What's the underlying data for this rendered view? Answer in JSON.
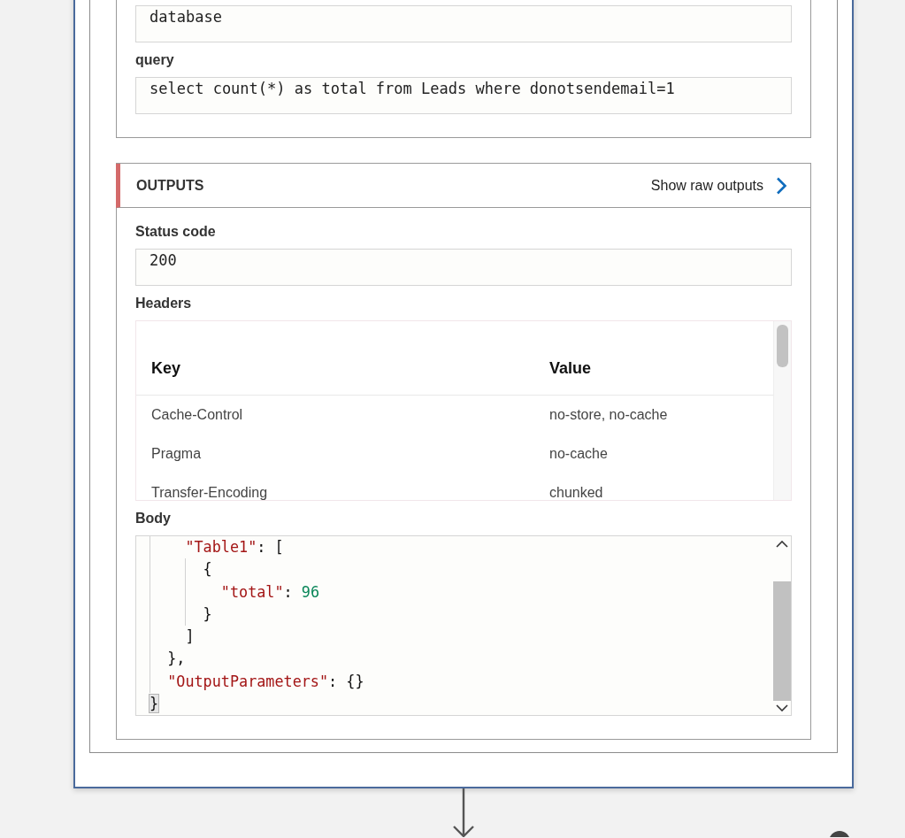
{
  "inputs": {
    "fields": [
      {
        "value": "database"
      },
      {
        "label": "query",
        "value": "select count(*) as total from Leads where donotsendemail=1"
      }
    ]
  },
  "outputs": {
    "title": "OUTPUTS",
    "raw_outputs_link": "Show raw outputs",
    "status_code": {
      "label": "Status code",
      "value": "200"
    },
    "headers": {
      "label": "Headers",
      "columns": [
        "Key",
        "Value"
      ],
      "rows": [
        {
          "key": "Cache-Control",
          "value": "no-store, no-cache"
        },
        {
          "key": "Pragma",
          "value": "no-cache"
        },
        {
          "key": "Transfer-Encoding",
          "value": "chunked"
        }
      ]
    },
    "body": {
      "label": "Body",
      "lines": [
        {
          "tokens": [
            {
              "kind": "key",
              "text": "    \"Table1\""
            },
            {
              "kind": "punct",
              "text": ": ["
            }
          ]
        },
        {
          "tokens": [
            {
              "kind": "punct",
              "text": "      {"
            }
          ]
        },
        {
          "tokens": [
            {
              "kind": "key",
              "text": "        \"total\""
            },
            {
              "kind": "punct",
              "text": ": "
            },
            {
              "kind": "number",
              "text": "96"
            }
          ]
        },
        {
          "tokens": [
            {
              "kind": "punct",
              "text": "      }"
            }
          ]
        },
        {
          "tokens": [
            {
              "kind": "punct",
              "text": "    ]"
            }
          ]
        },
        {
          "tokens": [
            {
              "kind": "punct",
              "text": "  },"
            }
          ]
        },
        {
          "tokens": [
            {
              "kind": "key",
              "text": "  \"OutputParameters\""
            },
            {
              "kind": "punct",
              "text": ": {}"
            }
          ]
        },
        {
          "tokens": [
            {
              "kind": "brace_match",
              "text": "}"
            }
          ]
        }
      ]
    }
  }
}
